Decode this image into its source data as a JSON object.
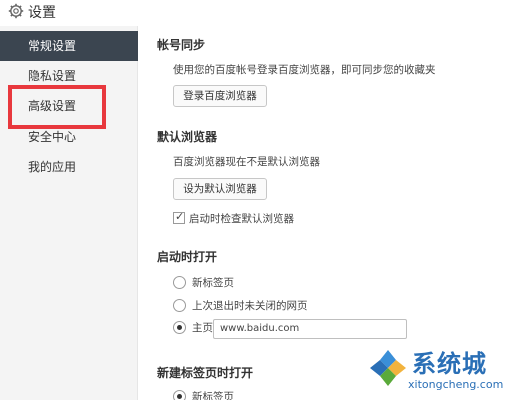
{
  "header": {
    "title": "设置",
    "icon": "gear-icon"
  },
  "sidebar": {
    "items": [
      {
        "label": "常规设置",
        "active": true
      },
      {
        "label": "隐私设置",
        "active": false
      },
      {
        "label": "高级设置",
        "active": false
      },
      {
        "label": "安全中心",
        "active": false
      },
      {
        "label": "我的应用",
        "active": false
      }
    ]
  },
  "account_sync": {
    "title": "帐号同步",
    "desc": "使用您的百度帐号登录百度浏览器，即可同步您的收藏夹",
    "login_button": "登录百度浏览器"
  },
  "default_browser": {
    "title": "默认浏览器",
    "desc": "百度浏览器现在不是默认浏览器",
    "set_button": "设为默认浏览器",
    "check_on_start_label": "启动时检查默认浏览器",
    "check_on_start": true
  },
  "startup": {
    "title": "启动时打开",
    "options": [
      "新标签页",
      "上次退出时未关闭的网页",
      "主页"
    ],
    "selected": "主页",
    "homepage_url": "www.baidu.com"
  },
  "new_tab": {
    "title": "新建标签页时打开",
    "options": [
      "新标签页"
    ]
  },
  "watermark": {
    "brand": "系统城",
    "url": "xitongcheng.com"
  },
  "colors": {
    "sidebar_active": "#3b4550",
    "highlight": "#e8383d",
    "brand": "#2a6fb6"
  }
}
